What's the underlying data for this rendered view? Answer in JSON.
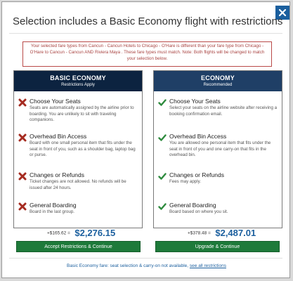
{
  "modal": {
    "title": "Selection includes a Basic Economy flight with restrictions",
    "alert": "Your selected fare types from Cancun - Cancun Hotels to Chicago - O'Hare is different than your fare type from Chicago - O'Hare to Cancun - Cancun AND Riviera Maya . These fare types must match. Note: Both flights will be changed to match your selection below."
  },
  "basic": {
    "title": "BASIC ECONOMY",
    "subtitle": "Restrictions Apply",
    "features": [
      {
        "title": "Choose Your Seats",
        "desc": "Seats are automatically assigned by the airline prior to boarding. You are unlikely to sit with traveling companions.",
        "icon": "x-icon"
      },
      {
        "title": "Overhead Bin Access",
        "desc": "Board with one small personal item that fits under the seat in front of you, such as a shoulder bag, laptop bag or purse.",
        "icon": "x-icon"
      },
      {
        "title": "Changes or Refunds",
        "desc": "Ticket changes are not allowed. No refunds will be issued after 24 hours.",
        "icon": "x-icon"
      },
      {
        "title": "General Boarding",
        "desc": "Board in the last group.",
        "icon": "x-icon"
      }
    ],
    "price_diff": "+$165.62 =",
    "price_total": "$2,276.15",
    "button": "Accept Restrictions & Continue"
  },
  "economy": {
    "title": "ECONOMY",
    "subtitle": "Recommended",
    "features": [
      {
        "title": "Choose Your Seats",
        "desc": "Select your seats on the airline website after receiving a booking confirmation email.",
        "icon": "check-icon"
      },
      {
        "title": "Overhead Bin Access",
        "desc": "You are allowed one personal item that fits under the seat in front of you and one carry-on that fits in the overhead bin.",
        "icon": "check-icon"
      },
      {
        "title": "Changes or Refunds",
        "desc": "Fees may apply.",
        "icon": "check-icon"
      },
      {
        "title": "General Boarding",
        "desc": "Board based on where you sit.",
        "icon": "check-icon"
      }
    ],
    "price_diff": "+$378.48 =",
    "price_total": "$2,487.01",
    "button": "Upgrade & Continue"
  },
  "footer": {
    "text": "Basic Economy fare: seat selection & carry-on not available,",
    "link": "see all restrictions"
  },
  "colors": {
    "x_red": "#a52a1f",
    "check_green": "#2e8b3e",
    "brand_blue": "#1b5f9e",
    "button_green": "#1e7a3a"
  }
}
